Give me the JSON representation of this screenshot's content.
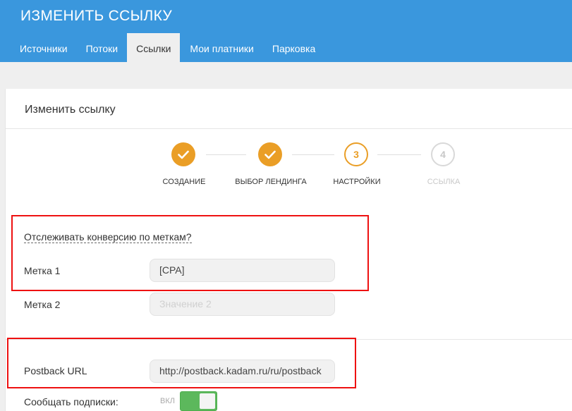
{
  "header": {
    "title": "ИЗМЕНИТЬ ССЫЛКУ",
    "tabs": [
      {
        "label": "Источники"
      },
      {
        "label": "Потоки"
      },
      {
        "label": "Ссылки"
      },
      {
        "label": "Мои платники"
      },
      {
        "label": "Парковка"
      }
    ],
    "active_tab": "Ссылки"
  },
  "card": {
    "title": "Изменить ссылку"
  },
  "stepper": {
    "steps": [
      {
        "label": "СОЗДАНИЕ",
        "state": "done",
        "icon": "check-icon"
      },
      {
        "label": "ВЫБОР ЛЕНДИНГА",
        "state": "done",
        "icon": "check-icon"
      },
      {
        "label": "НАСТРОЙКИ",
        "state": "current",
        "number": "3"
      },
      {
        "label": "ССЫЛКА",
        "state": "future",
        "number": "4"
      }
    ]
  },
  "form": {
    "track_conversion_link": "Отслеживать конверсию по меткам?",
    "tag1_label": "Метка 1",
    "tag1_value": "[CPA]",
    "tag2_label": "Метка 2",
    "tag2_placeholder": "Значение 2",
    "postback_label": "Postback URL",
    "postback_value": "http://postback.kadam.ru/ru/postback",
    "notify_label": "Сообщать подписки:",
    "notify_state": "ВКЛ",
    "notify_enabled": true
  },
  "colors": {
    "header_bg": "#3a97dd",
    "accent": "#ea9e26",
    "toggle_on": "#5cb85c",
    "highlight": "#ee1111"
  }
}
